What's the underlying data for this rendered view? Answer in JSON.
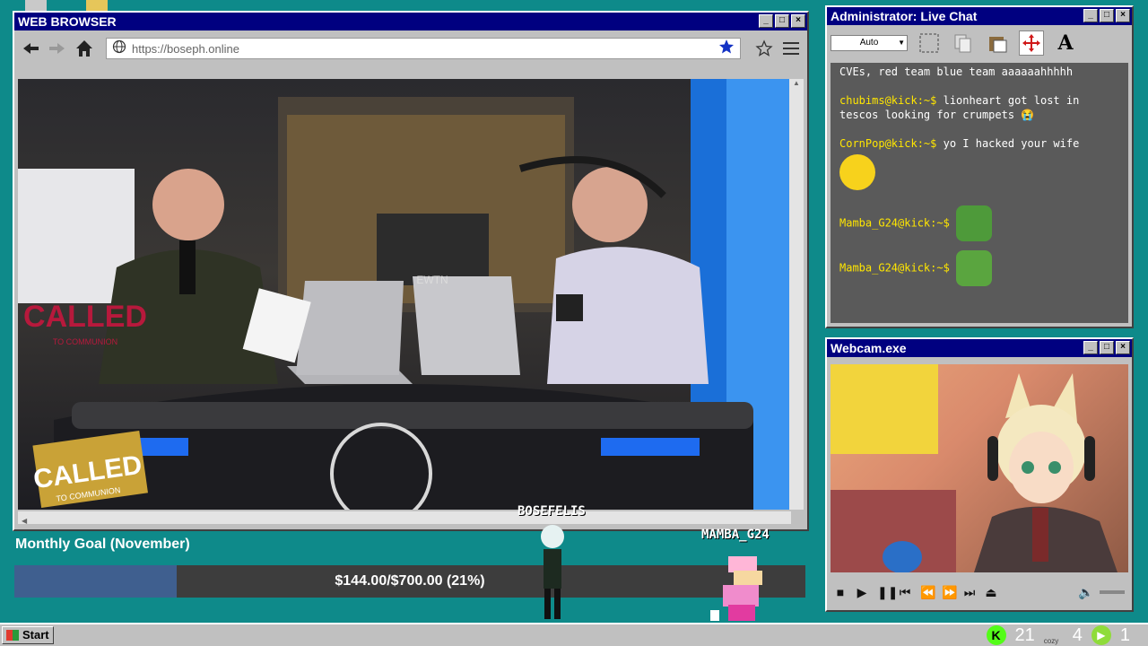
{
  "browser": {
    "title": "WEB BROWSER",
    "url": "https://boseph.online",
    "back_icon": "arrow-left-icon",
    "forward_icon": "arrow-right-icon",
    "home_icon": "home-icon",
    "bookmark_icon": "star-filled-icon",
    "favorite_icon": "star-outline-icon",
    "menu_icon": "hamburger-icon",
    "video": {
      "left_sign": "CALLED",
      "left_sign_sub": "TO COMMUNION",
      "desk_sign": "CALLED",
      "desk_sign_sub": "TO COMMUNION",
      "monitor_logo": "EWTN"
    }
  },
  "chat": {
    "title": "Administrator: Live Chat",
    "select_value": "Auto",
    "messages": [
      {
        "user": "",
        "text": "CVEs, red team blue team aaaaaahhhhh"
      },
      {
        "user": "chubims@kick:~$",
        "text": "lionheart got lost in tescos looking for crumpets 😭"
      },
      {
        "user": "CornPop@kick:~$",
        "text": "yo I hacked your wife"
      },
      {
        "user": "Mamba_G24@kick:~$",
        "text": ""
      },
      {
        "user": "Mamba_G24@kick:~$",
        "text": ""
      }
    ]
  },
  "webcam": {
    "title": "Webcam.exe"
  },
  "goal": {
    "label": "Monthly Goal (November)",
    "progress_text": "$144.00/$700.00 (21%)",
    "progress_fraction": 0.2057
  },
  "sprites": {
    "first": "BOSEFELIS",
    "second": "MAMBA_G24"
  },
  "taskbar": {
    "start_label": "Start",
    "tray_count_1": "21",
    "tray_count_2": "4",
    "tray_count_3": "1",
    "tray_app_label": "cozy"
  },
  "colors": {
    "desktop": "#0e8a8a",
    "titlebar": "#000080",
    "goal_fill": "#3f5f8f",
    "chat_user": "#ffe600",
    "kick_green": "#53fc18"
  }
}
